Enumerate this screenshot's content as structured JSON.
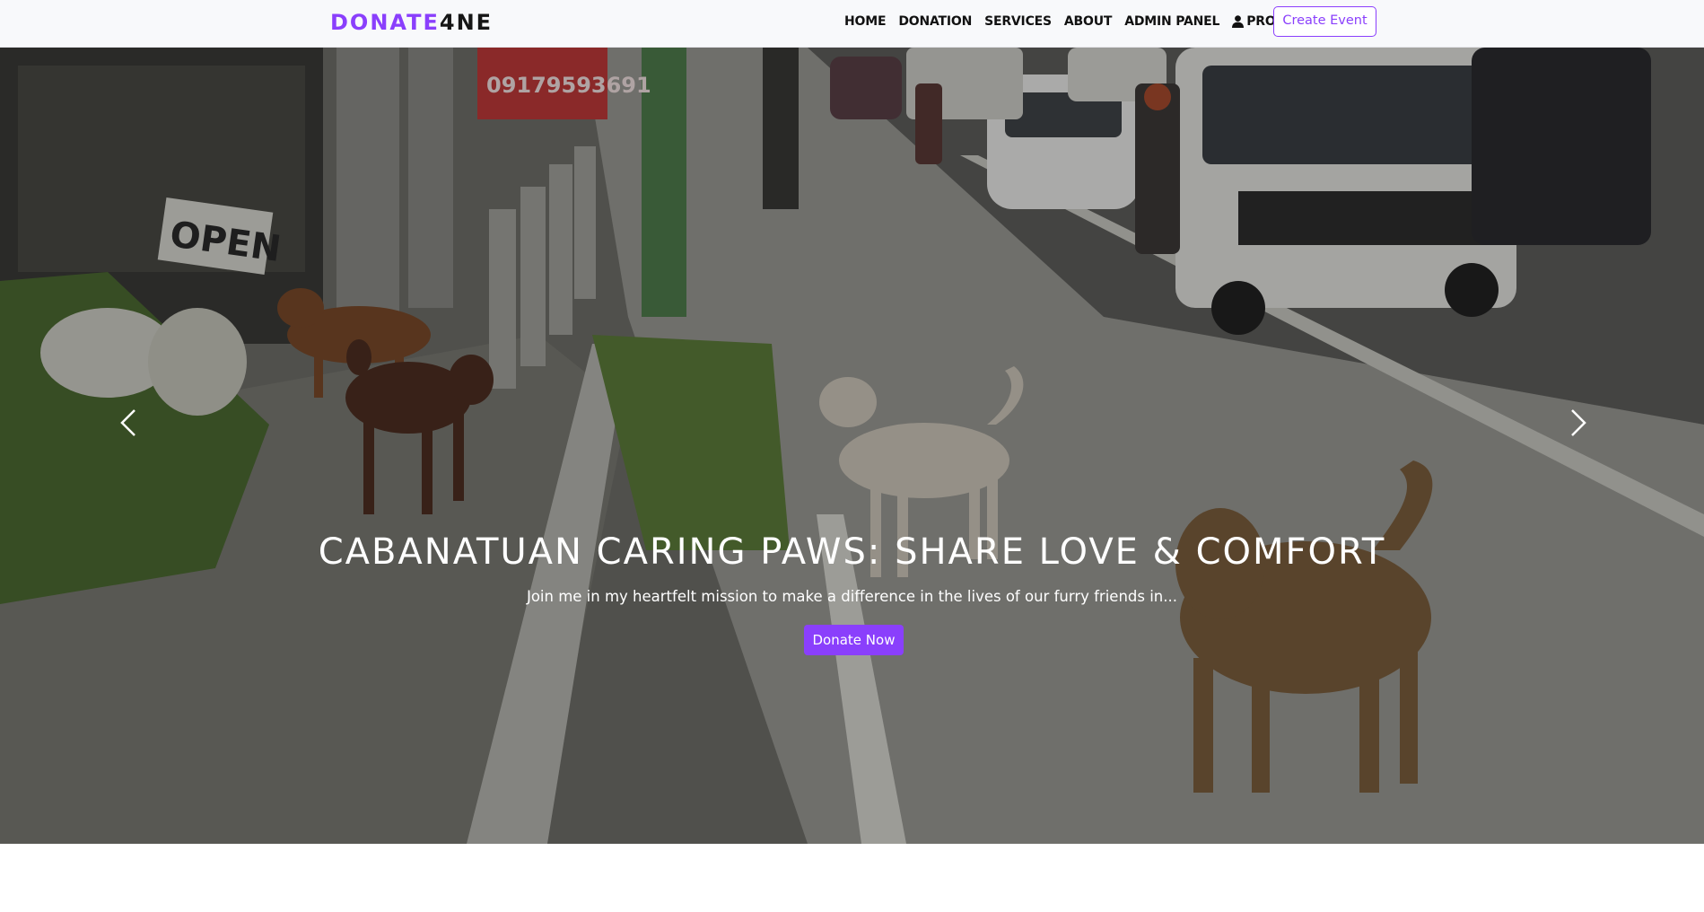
{
  "brand": {
    "part1": "DONATE",
    "part2": "4NE"
  },
  "nav": {
    "home": "HOME",
    "donation": "DONATION",
    "services": "SERVICES",
    "about": "ABOUT",
    "admin": "ADMIN PANEL",
    "profile": "PROFILE",
    "create_event": "Create Event"
  },
  "hero": {
    "title": "CABANATUAN CARING PAWS: SHARE LOVE & COMFORT",
    "subtitle": "Join me in my heartfelt mission to make a difference in the lives of our furry friends in...",
    "cta": "Donate Now",
    "sign_phone": "09179593691",
    "sign_open": "OPEN"
  },
  "colors": {
    "accent": "#8a3ffc",
    "nav_bg": "#f8f9fb"
  },
  "icons": {
    "profile": "user-icon",
    "prev": "chevron-left-icon",
    "next": "chevron-right-icon"
  }
}
